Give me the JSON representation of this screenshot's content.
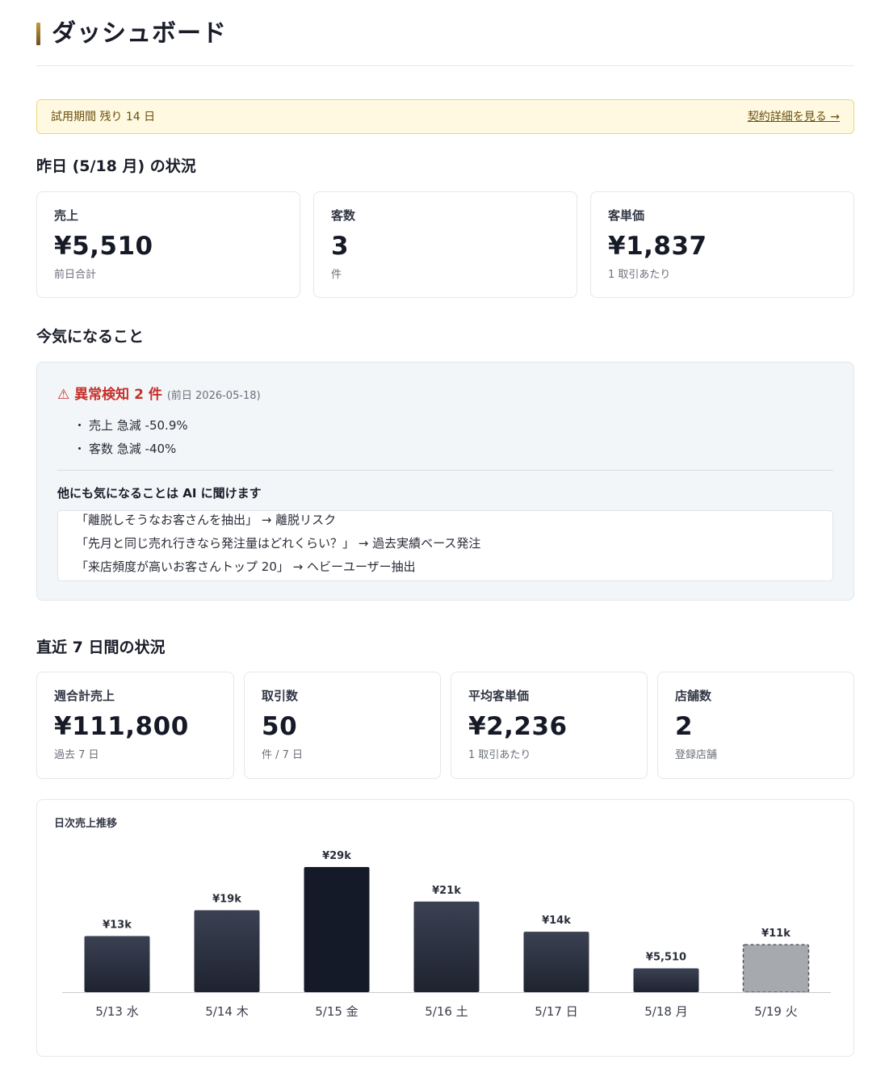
{
  "header": {
    "title": "ダッシュボード"
  },
  "trial": {
    "message": "試用期間 残り 14 日",
    "link": "契約詳細を見る →"
  },
  "yesterday": {
    "title": "昨日 (5/18 月) の状況",
    "cards": [
      {
        "label": "売上",
        "value": "¥5,510",
        "sub": "前日合計"
      },
      {
        "label": "客数",
        "value": "3",
        "sub": "件"
      },
      {
        "label": "客単価",
        "value": "¥1,837",
        "sub": "1 取引あたり"
      }
    ]
  },
  "concerns": {
    "title": "今気になること",
    "alert": {
      "label": "⚠ 異常検知 2 件",
      "date": "(前日 2026-05-18)"
    },
    "items": [
      "売上 急減 -50.9%",
      "客数 急減 -40%"
    ],
    "ai_title": "他にも気になることは AI に聞けます",
    "questions": [
      "「離脱しそうなお客さんを抽出」 → 離脱リスク",
      "「先月と同じ売れ行きなら発注量はどれくらい？」 → 過去実績ベース発注",
      "「来店頻度が高いお客さんトップ 20」 → ヘビーユーザー抽出"
    ]
  },
  "week": {
    "title": "直近 7 日間の状況",
    "cards": [
      {
        "label": "週合計売上",
        "value": "¥111,800",
        "sub": "過去 7 日"
      },
      {
        "label": "取引数",
        "value": "50",
        "sub": "件 / 7 日"
      },
      {
        "label": "平均客単価",
        "value": "¥2,236",
        "sub": "1 取引あたり"
      },
      {
        "label": "店舗数",
        "value": "2",
        "sub": "登録店舗"
      }
    ]
  },
  "chart_data": {
    "type": "bar",
    "title": "日次売上推移",
    "categories": [
      "5/13 水",
      "5/14 木",
      "5/15 金",
      "5/16 土",
      "5/17 日",
      "5/18 月",
      "5/19 火"
    ],
    "values": [
      13000,
      19000,
      29000,
      21000,
      14000,
      5510,
      11000
    ],
    "value_labels": [
      "¥13k",
      "¥19k",
      "¥29k",
      "¥21k",
      "¥14k",
      "¥5,510",
      "¥11k"
    ],
    "highlight_index": 2,
    "forecast_index": 6,
    "ylim": [
      0,
      29000
    ],
    "grid": false,
    "colors": {
      "bar": "#2b3040",
      "highlight": "#151a28",
      "forecast": "#a6a9ae"
    }
  }
}
